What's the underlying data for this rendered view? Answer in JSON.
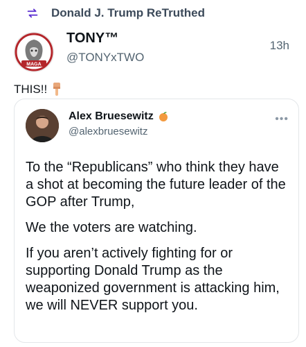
{
  "retruth": {
    "text": "Donald J. Trump ReTruthed"
  },
  "author": {
    "name": "TONY™",
    "handle": "@TONYxTWO",
    "time": "13h",
    "avatar_logo_text": "MAGA"
  },
  "post": {
    "text": "THIS!!"
  },
  "quoted": {
    "name": "Alex Bruesewitz",
    "handle": "@alexbruesewitz",
    "paragraphs": [
      "To the “Republicans” who think they have a shot at becoming the future leader of the GOP after Trump,",
      "We the voters are watching.",
      "If you aren’t actively fighting for or supporting Donald Trump as the weaponized government is attacking him, we will NEVER support you."
    ]
  },
  "icons": {
    "retruth": "retruth-icon",
    "finger": "pointing-down-icon",
    "peach": "peach-icon",
    "more": "more-options-icon"
  },
  "colors": {
    "muted": "#536471",
    "card_border": "#e3e6e9"
  }
}
